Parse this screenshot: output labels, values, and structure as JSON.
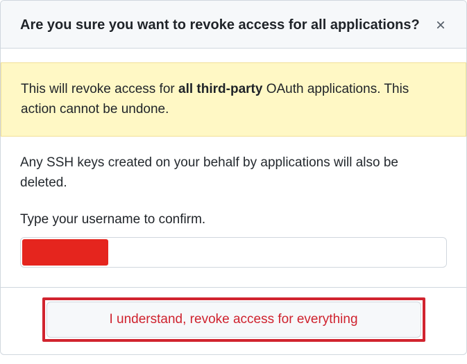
{
  "dialog": {
    "title": "Are you sure you want to revoke access for all applications?",
    "warning": {
      "prefix": "This will revoke access for ",
      "bold": "all third-party",
      "suffix": " OAuth applications. This action cannot be undone."
    },
    "body_text": "Any SSH keys created on your behalf by applications will also be deleted.",
    "confirm_label": "Type your username to confirm.",
    "input_value": "",
    "revoke_button": "I understand, revoke access for everything"
  }
}
